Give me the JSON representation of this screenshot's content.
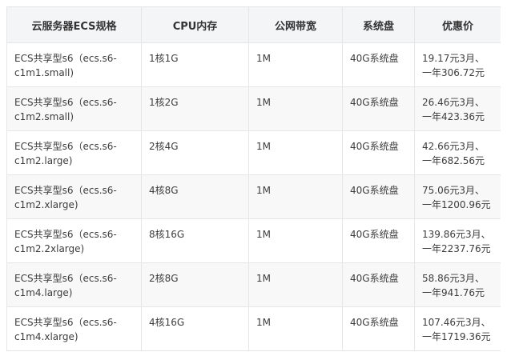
{
  "table": {
    "headers": [
      "云服务器ECS规格",
      "CPU内存",
      "公网带宽",
      "系统盘",
      "优惠价"
    ],
    "rows": [
      {
        "name_line1": "ECS共享型s6（ecs.s6-",
        "name_line2": "c1m1.small)",
        "cpu_mem": "1核1G",
        "bandwidth": "1M",
        "disk": "40G系统盘",
        "price_line1": "19.17元3月、",
        "price_line2": "一年306.72元"
      },
      {
        "name_line1": "ECS共享型s6（ecs.s6-",
        "name_line2": "c1m2.small)",
        "cpu_mem": "1核2G",
        "bandwidth": "1M",
        "disk": "40G系统盘",
        "price_line1": "26.46元3月、",
        "price_line2": "一年423.36元"
      },
      {
        "name_line1": "ECS共享型s6（ecs.s6-",
        "name_line2": "c1m2.large)",
        "cpu_mem": "2核4G",
        "bandwidth": "1M",
        "disk": "40G系统盘",
        "price_line1": "42.66元3月、",
        "price_line2": "一年682.56元"
      },
      {
        "name_line1": "ECS共享型s6（ecs.s6-",
        "name_line2": "c1m2.xlarge)",
        "cpu_mem": "4核8G",
        "bandwidth": "1M",
        "disk": "40G系统盘",
        "price_line1": "75.06元3月、",
        "price_line2": "一年1200.96元"
      },
      {
        "name_line1": "ECS共享型s6（ecs.s6-",
        "name_line2": "c1m2.2xlarge)",
        "cpu_mem": "8核16G",
        "bandwidth": "1M",
        "disk": "40G系统盘",
        "price_line1": "139.86元3月、",
        "price_line2": "一年2237.76元"
      },
      {
        "name_line1": "ECS共享型s6（ecs.s6-",
        "name_line2": "c1m4.large)",
        "cpu_mem": "2核8G",
        "bandwidth": "1M",
        "disk": "40G系统盘",
        "price_line1": "58.86元3月、",
        "price_line2": "一年941.76元"
      },
      {
        "name_line1": "ECS共享型s6（ecs.s6-",
        "name_line2": "c1m4.xlarge)",
        "cpu_mem": "4核16G",
        "bandwidth": "1M",
        "disk": "40G系统盘",
        "price_line1": "107.46元3月、",
        "price_line2": "一年1719.36元"
      }
    ]
  }
}
